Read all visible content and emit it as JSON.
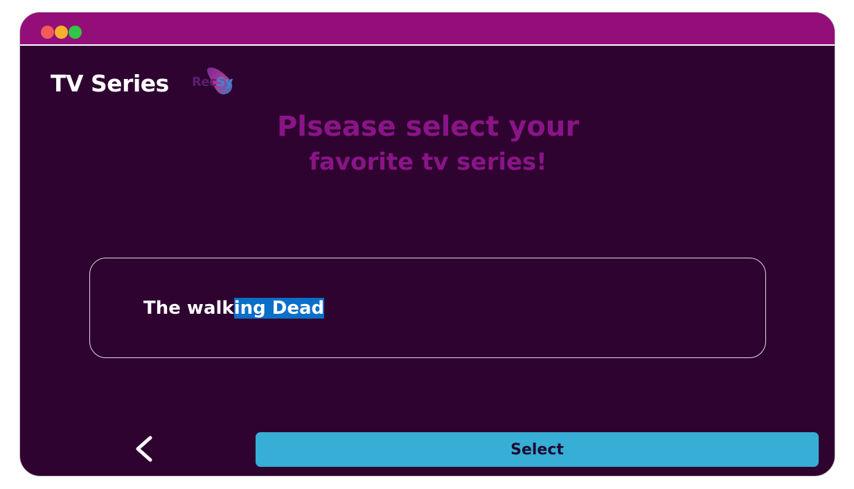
{
  "window": {
    "controls": [
      {
        "name": "close",
        "color": "#f25b5b"
      },
      {
        "name": "minimize",
        "color": "#f6b12b"
      },
      {
        "name": "maximize",
        "color": "#2fc844"
      }
    ]
  },
  "header": {
    "title": "TV Series",
    "logo": {
      "part1": "Rec",
      "part2": "Sy"
    }
  },
  "prompt": {
    "line1": "Plsease select your",
    "line2": "favorite tv series!"
  },
  "series_input": {
    "value_unselected": "The walk",
    "value_selected": "ing Dead"
  },
  "footer": {
    "back_icon": "chevron-left-icon",
    "select_label": "Select"
  },
  "colors": {
    "background": "#2f0330",
    "titlebar": "#940e7a",
    "prompt_text": "#8a1487",
    "select_button": "#36aed6",
    "text_selection": "#0a6fc9"
  }
}
